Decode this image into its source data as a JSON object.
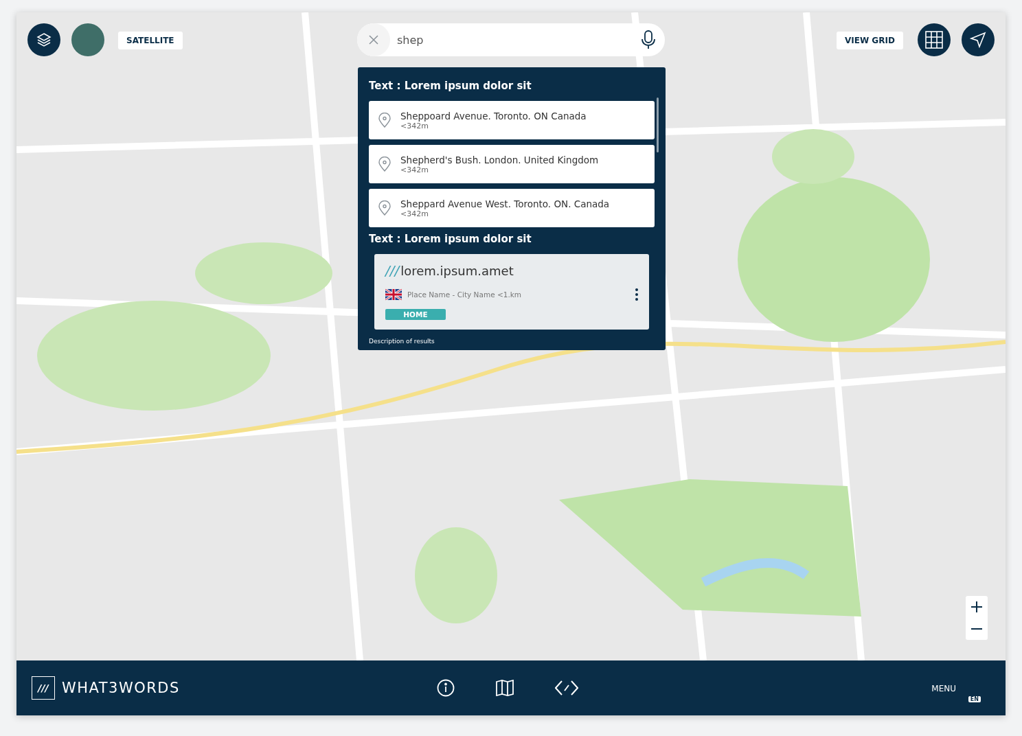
{
  "map_controls": {
    "satellite_label": "SATELLITE",
    "grid_label": "VIEW GRID"
  },
  "search": {
    "value": "shep"
  },
  "results": {
    "sections": [
      {
        "kind": "suggestions",
        "heading": "Text : Lorem ipsum dolor sit",
        "items": [
          {
            "title": "Sheppoard Avenue. Toronto. ON Canada",
            "distance": "<342m"
          },
          {
            "title": "Shepherd's Bush. London. United Kingdom",
            "distance": "<342m"
          },
          {
            "title": "Sheppard Avenue West. Toronto. ON. Canada",
            "distance": "<342m"
          }
        ]
      },
      {
        "kind": "address",
        "heading": "Text : Lorem ipsum dolor sit",
        "prefix": "///",
        "words": "lorem.ipsum.amet",
        "place": "Place Name - City Name <1.km",
        "tag": "HOME"
      }
    ],
    "description": "Description of results"
  },
  "footer": {
    "logo_mark": "///",
    "brand": "WHAT3WORDS",
    "menu": "MENU",
    "language": "EN"
  }
}
